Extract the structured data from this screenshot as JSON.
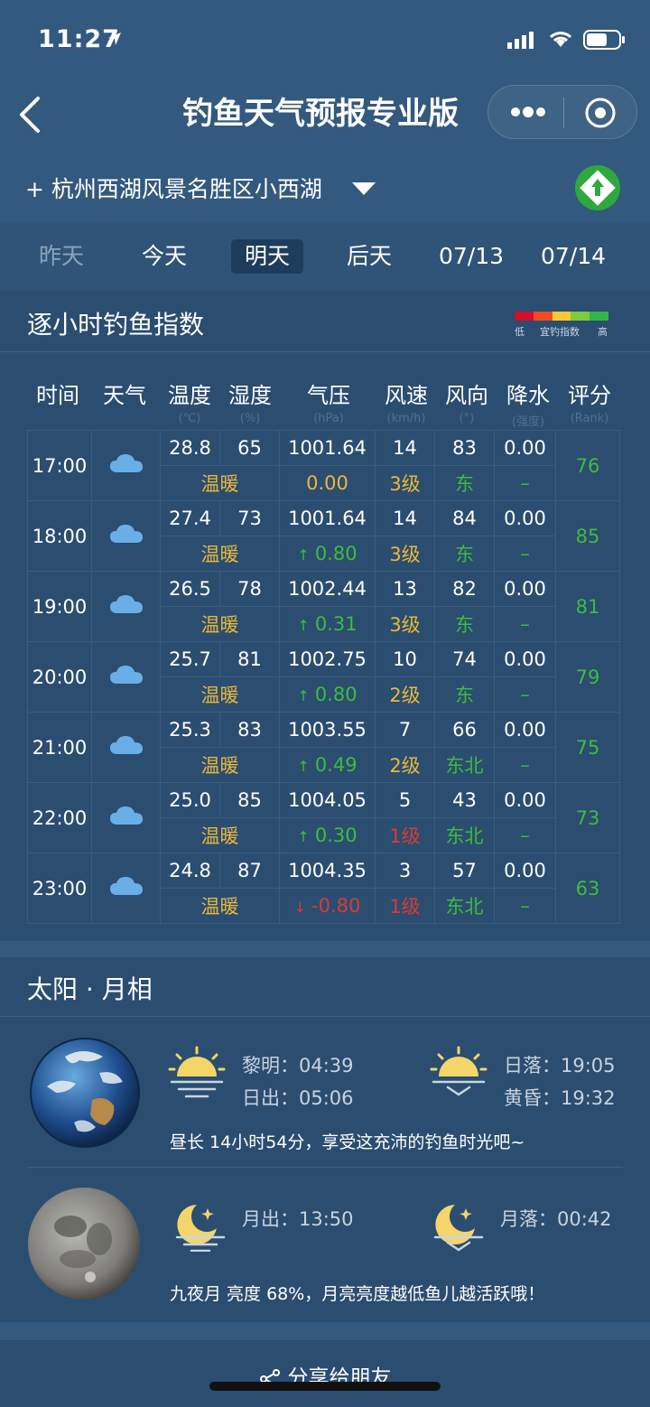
{
  "status": {
    "time": "11:27"
  },
  "nav": {
    "title": "钓鱼天气预报专业版"
  },
  "location": {
    "label": "+ 杭州西湖风景名胜区小西湖"
  },
  "tabs": [
    "昨天",
    "今天",
    "明天",
    "后天",
    "07/13",
    "07/14"
  ],
  "selected_tab": "明天",
  "hourly": {
    "title": "逐小时钓鱼指数",
    "legend": {
      "low": "低",
      "mid": "宜钓指数",
      "high": "高",
      "colors": [
        "#d0112b",
        "#ef4b23",
        "#f7c934",
        "#7ecb3c",
        "#33b54a"
      ]
    },
    "columns": [
      {
        "name": "时间",
        "unit": ""
      },
      {
        "name": "天气",
        "unit": ""
      },
      {
        "name": "温度",
        "unit": "(℃)"
      },
      {
        "name": "湿度",
        "unit": "(%)"
      },
      {
        "name": "气压",
        "unit": "(hPa)"
      },
      {
        "name": "风速",
        "unit": "(km/h)"
      },
      {
        "name": "风向",
        "unit": "(°)"
      },
      {
        "name": "降水",
        "unit": "(强度)"
      },
      {
        "name": "评分",
        "unit": "(Rank)"
      }
    ],
    "rows": [
      {
        "time": "17:00",
        "temp": "28.8",
        "hum": "65",
        "press": "1001.64",
        "wind": "14",
        "dir": "83",
        "rain": "0.00",
        "feel": "温暖",
        "press_delta": "0.00",
        "trend": "flat",
        "level": "3级",
        "level_color": "y",
        "dir_text": "东",
        "rain_text": "–",
        "rank": "76"
      },
      {
        "time": "18:00",
        "temp": "27.4",
        "hum": "73",
        "press": "1001.64",
        "wind": "14",
        "dir": "84",
        "rain": "0.00",
        "feel": "温暖",
        "press_delta": "0.80",
        "trend": "up",
        "level": "3级",
        "level_color": "y",
        "dir_text": "东",
        "rain_text": "–",
        "rank": "85"
      },
      {
        "time": "19:00",
        "temp": "26.5",
        "hum": "78",
        "press": "1002.44",
        "wind": "13",
        "dir": "82",
        "rain": "0.00",
        "feel": "温暖",
        "press_delta": "0.31",
        "trend": "up",
        "level": "3级",
        "level_color": "y",
        "dir_text": "东",
        "rain_text": "–",
        "rank": "81"
      },
      {
        "time": "20:00",
        "temp": "25.7",
        "hum": "81",
        "press": "1002.75",
        "wind": "10",
        "dir": "74",
        "rain": "0.00",
        "feel": "温暖",
        "press_delta": "0.80",
        "trend": "up",
        "level": "2级",
        "level_color": "y",
        "dir_text": "东",
        "rain_text": "–",
        "rank": "79"
      },
      {
        "time": "21:00",
        "temp": "25.3",
        "hum": "83",
        "press": "1003.55",
        "wind": "7",
        "dir": "66",
        "rain": "0.00",
        "feel": "温暖",
        "press_delta": "0.49",
        "trend": "up",
        "level": "2级",
        "level_color": "y",
        "dir_text": "东北",
        "rain_text": "–",
        "rank": "75"
      },
      {
        "time": "22:00",
        "temp": "25.0",
        "hum": "85",
        "press": "1004.05",
        "wind": "5",
        "dir": "43",
        "rain": "0.00",
        "feel": "温暖",
        "press_delta": "0.30",
        "trend": "up",
        "level": "1级",
        "level_color": "r",
        "dir_text": "东北",
        "rain_text": "–",
        "rank": "73"
      },
      {
        "time": "23:00",
        "temp": "24.8",
        "hum": "87",
        "press": "1004.35",
        "wind": "3",
        "dir": "57",
        "rain": "0.00",
        "feel": "温暖",
        "press_delta": "-0.80",
        "trend": "down",
        "level": "1级",
        "level_color": "r",
        "dir_text": "东北",
        "rain_text": "–",
        "rank": "63"
      }
    ]
  },
  "sunmoon": {
    "title": "太阳 · 月相",
    "dawn": "黎明：04:39",
    "sunrise": "日出：05:06",
    "sunset": "日落：19:05",
    "dusk": "黄昏：19:32",
    "day_note": "昼长 14小时54分，享受这充沛的钓鱼时光吧~",
    "moonrise": "月出：13:50",
    "moonset": "月落：00:42",
    "moon_note": "九夜月 亮度 68%，月亮亮度越低鱼儿越活跃哦！"
  },
  "footer": {
    "share": "分享给朋友"
  }
}
